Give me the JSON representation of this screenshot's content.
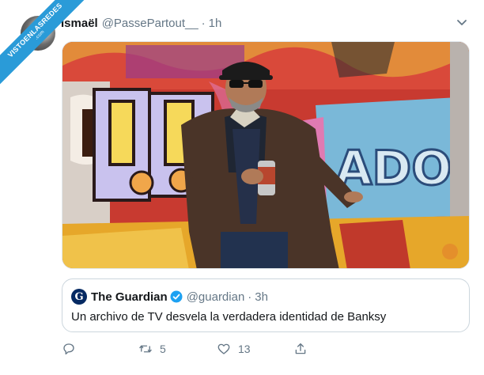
{
  "ribbon": {
    "text": "VISTOENLASREDES",
    "subtext": ".com"
  },
  "tweet": {
    "author_name": "Ismaël",
    "author_handle": "@PassePartout__",
    "separator": "·",
    "time": "1h"
  },
  "quote": {
    "logo_letter": "G",
    "name": "The Guardian",
    "handle": "@guardian",
    "separator": "·",
    "time": "3h",
    "text": "Un archivo de TV desvela la verdadera identidad de Banksy"
  },
  "actions": {
    "reply_count": "",
    "retweet_count": "5",
    "like_count": "13"
  },
  "icons": [
    "reply-icon",
    "retweet-icon",
    "like-icon",
    "share-icon",
    "chevron-down-icon",
    "verified-icon"
  ],
  "colors": {
    "ribbon": "#2a9bd8",
    "verified": "#1da1f2",
    "muted": "#657786",
    "border": "#ccd6dd"
  }
}
